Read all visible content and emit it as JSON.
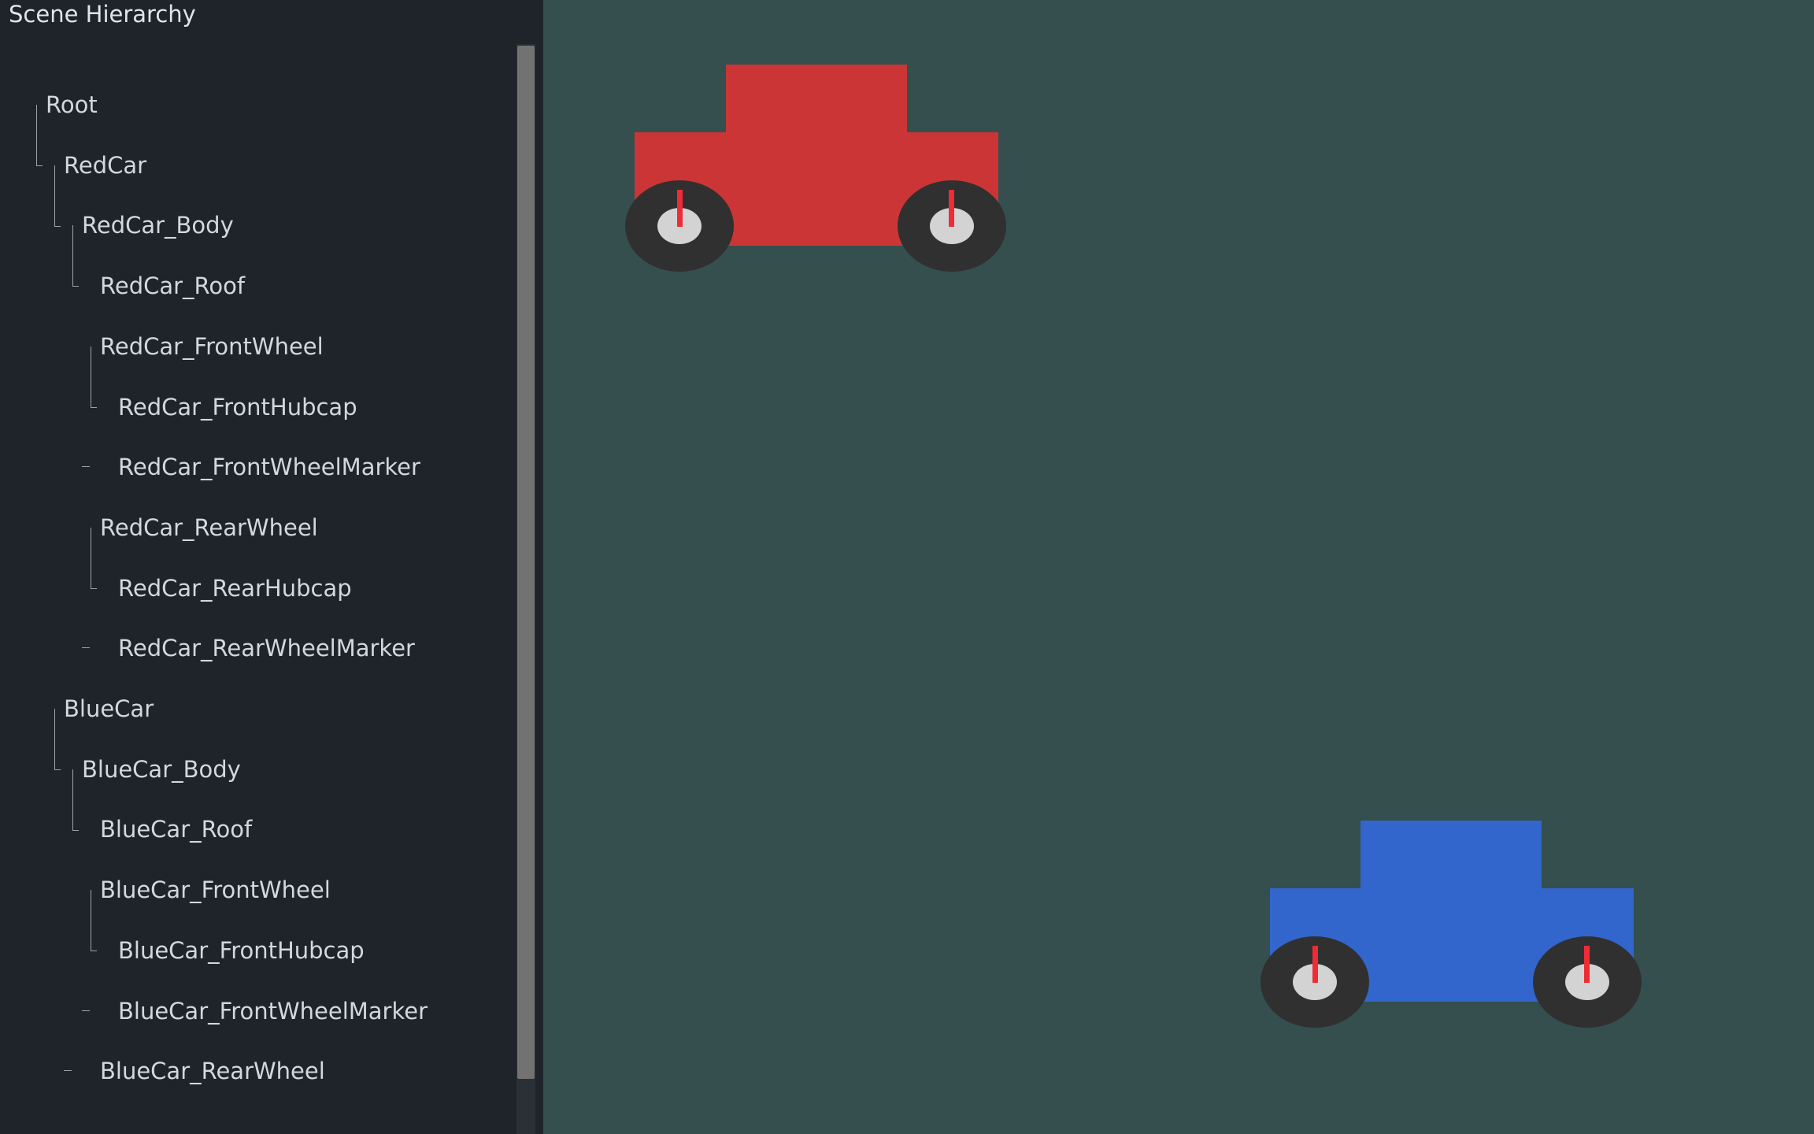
{
  "panel": {
    "title": "Scene Hierarchy",
    "items": [
      {
        "label": "Root",
        "depth": 0,
        "connector": "guide"
      },
      {
        "label": "RedCar",
        "depth": 1,
        "connector": "guide"
      },
      {
        "label": "RedCar_Body",
        "depth": 2,
        "connector": "guide"
      },
      {
        "label": "RedCar_Roof",
        "depth": 3,
        "connector": "none"
      },
      {
        "label": "RedCar_FrontWheel",
        "depth": 3,
        "connector": "guide"
      },
      {
        "label": "RedCar_FrontHubcap",
        "depth": 4,
        "connector": "none"
      },
      {
        "label": "RedCar_FrontWheelMarker",
        "depth": 4,
        "connector": "dash"
      },
      {
        "label": "RedCar_RearWheel",
        "depth": 3,
        "connector": "guide"
      },
      {
        "label": "RedCar_RearHubcap",
        "depth": 4,
        "connector": "none"
      },
      {
        "label": "RedCar_RearWheelMarker",
        "depth": 4,
        "connector": "dash"
      },
      {
        "label": "BlueCar",
        "depth": 1,
        "connector": "guide"
      },
      {
        "label": "BlueCar_Body",
        "depth": 2,
        "connector": "guide"
      },
      {
        "label": "BlueCar_Roof",
        "depth": 3,
        "connector": "none"
      },
      {
        "label": "BlueCar_FrontWheel",
        "depth": 3,
        "connector": "guide"
      },
      {
        "label": "BlueCar_FrontHubcap",
        "depth": 4,
        "connector": "none"
      },
      {
        "label": "BlueCar_FrontWheelMarker",
        "depth": 4,
        "connector": "dash"
      },
      {
        "label": "BlueCar_RearWheel",
        "depth": 3,
        "connector": "dash"
      }
    ]
  },
  "scene": {
    "background": "#344f4e",
    "cars": [
      {
        "name": "RedCar",
        "body_color": "#cc3535",
        "wheel_color": "#303030",
        "hubcap_color": "#d3d3d3",
        "marker_color": "#ee2c36"
      },
      {
        "name": "BlueCar",
        "body_color": "#3266cc",
        "wheel_color": "#303030",
        "hubcap_color": "#d3d3d3",
        "marker_color": "#ee2c36"
      }
    ]
  }
}
